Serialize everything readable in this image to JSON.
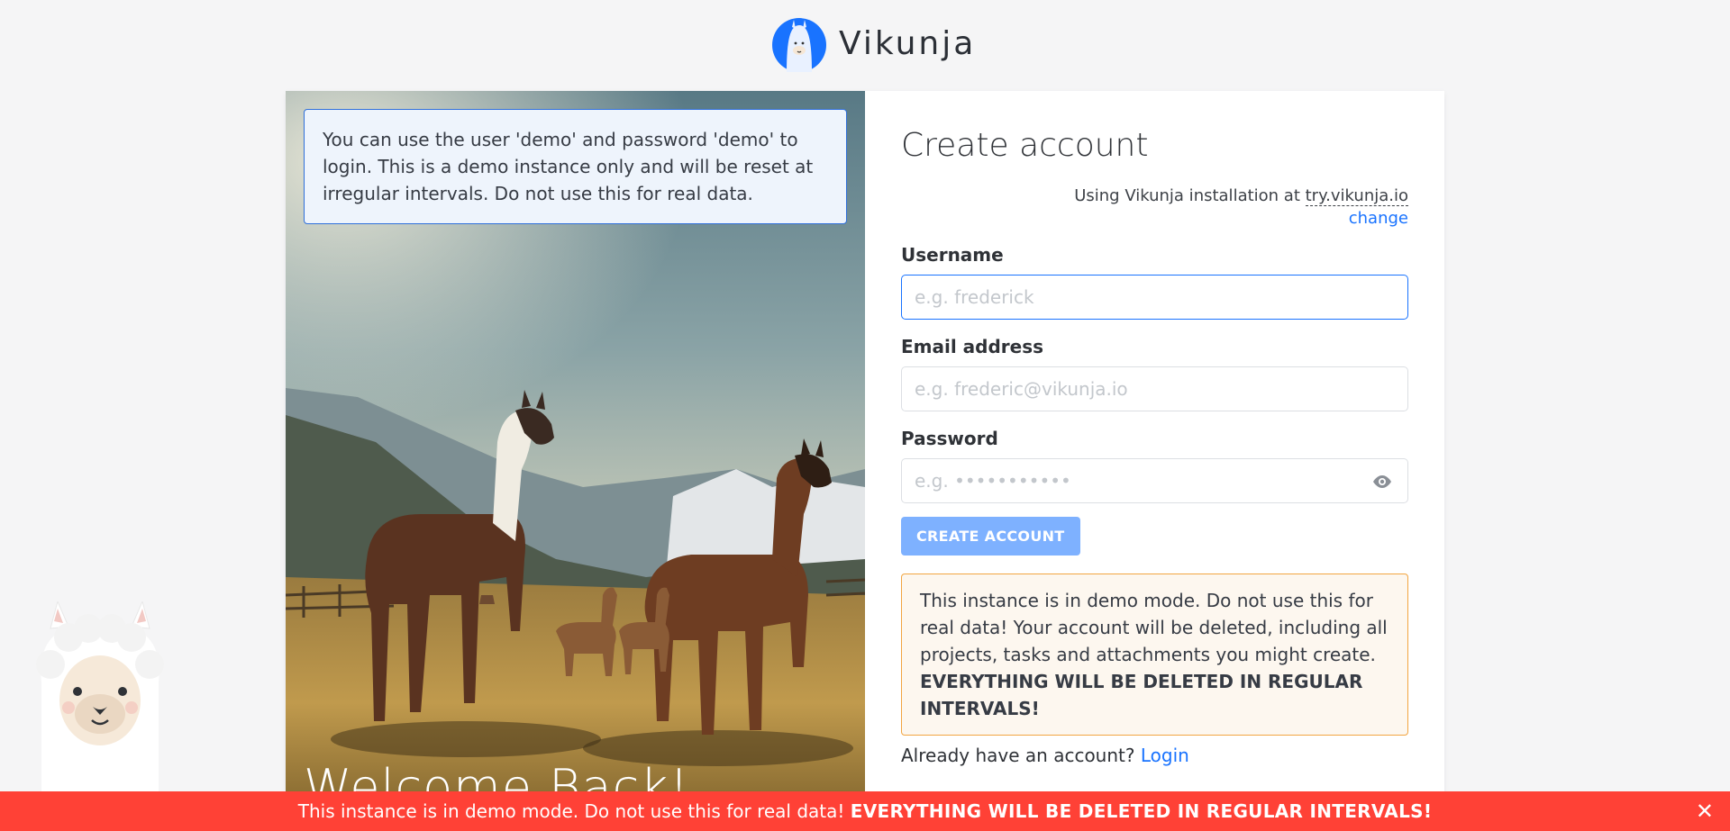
{
  "brand": {
    "name": "Vikunja"
  },
  "image_panel": {
    "info_text": "You can use the user 'demo' and password 'demo' to login. This is a demo instance only and will be reset at irregular intervals. Do not use this for real data.",
    "welcome_text": "Welcome Back!"
  },
  "form": {
    "title": "Create account",
    "install_prefix": "Using Vikunja installation at",
    "install_url": "try.vikunja.io",
    "change_label": "change",
    "username_label": "Username",
    "username_placeholder": "e.g. frederick",
    "email_label": "Email address",
    "email_placeholder": "e.g. frederic@vikunja.io",
    "password_label": "Password",
    "password_placeholder": "e.g. •••••••••••",
    "submit_label": "CREATE ACCOUNT",
    "warning_text": "This instance is in demo mode. Do not use this for real data! Your account will be deleted, including all projects, tasks and attachments you might create.",
    "warning_bold": "EVERYTHING WILL BE DELETED IN REGULAR INTERVALS!",
    "login_prompt": "Already have an account?",
    "login_link": "Login"
  },
  "banner": {
    "text": "This instance is in demo mode. Do not use this for real data!",
    "bold": "EVERYTHING WILL BE DELETED IN REGULAR INTERVALS!",
    "close_glyph": "✕"
  },
  "colors": {
    "primary": "#1973ff",
    "banner_bg": "#ff4136",
    "warning_border": "#f2a541",
    "info_border": "#2f6fd9"
  }
}
